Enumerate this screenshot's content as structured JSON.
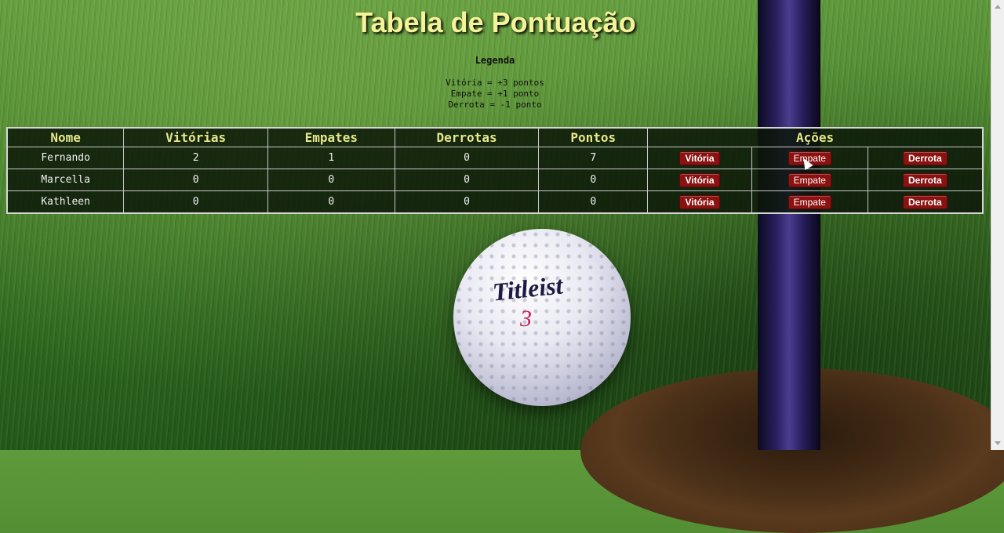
{
  "page": {
    "title": "Tabela de Pontuação"
  },
  "legend": {
    "title": "Legenda",
    "lines": [
      "Vitória = +3 pontos",
      "Empate = +1 ponto",
      "Derrota = -1 ponto"
    ]
  },
  "table": {
    "headers": [
      "Nome",
      "Vitórias",
      "Empates",
      "Derrotas",
      "Pontos",
      "Ações"
    ],
    "rows": [
      {
        "name": "Fernando",
        "wins": "2",
        "draws": "1",
        "losses": "0",
        "points": "7"
      },
      {
        "name": "Marcella",
        "wins": "0",
        "draws": "0",
        "losses": "0",
        "points": "0"
      },
      {
        "name": "Kathleen",
        "wins": "0",
        "draws": "0",
        "losses": "0",
        "points": "0"
      }
    ],
    "actions": {
      "win": "Vitória",
      "draw": "Empate",
      "loss": "Derrota"
    }
  },
  "background": {
    "ball_brand": "Titleist",
    "ball_number": "3"
  },
  "colors": {
    "title": "#f6f29a",
    "header_text": "#e6e88a",
    "button_bg": "#8c1111"
  }
}
